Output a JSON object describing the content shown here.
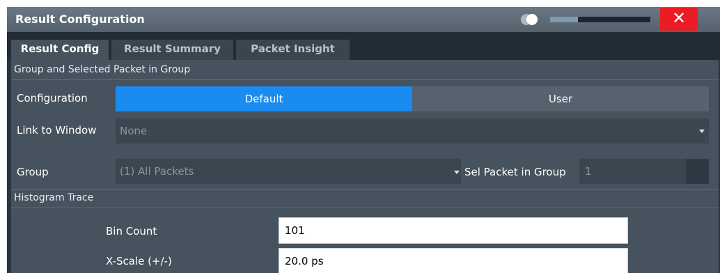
{
  "window": {
    "title": "Result Configuration",
    "close_label": "✕",
    "transparency_fraction": 0.28
  },
  "tabs": [
    {
      "label": "Result Config",
      "active": true
    },
    {
      "label": "Result Summary",
      "active": false
    },
    {
      "label": "Packet Insight",
      "active": false
    }
  ],
  "group_section": {
    "label": "Group and Selected Packet in Group",
    "configuration": {
      "label": "Configuration",
      "options": [
        "Default",
        "User"
      ],
      "selected": "Default"
    },
    "link_to_window": {
      "label": "Link to Window",
      "value": "None"
    },
    "group": {
      "label": "Group",
      "value": "(1) All Packets"
    },
    "sel_packet": {
      "label": "Sel Packet in Group",
      "value": "1"
    }
  },
  "histogram_section": {
    "label": "Histogram Trace",
    "bin_count": {
      "label": "Bin Count",
      "value": "101"
    },
    "x_scale": {
      "label": "X-Scale (+/-)",
      "value": "20.0 ps"
    }
  },
  "colors": {
    "accent": "#1a8cf0",
    "close": "#ec1c24"
  }
}
